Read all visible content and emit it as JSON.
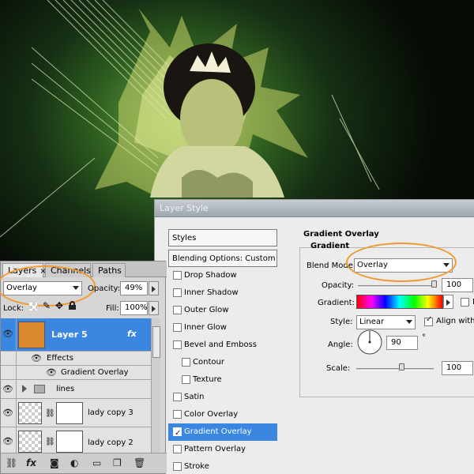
{
  "layer_style": {
    "title": "Layer Style",
    "styles_header": "Styles",
    "blending_options": "Blending Options: Custom",
    "items": [
      {
        "label": "Drop Shadow",
        "checked": false,
        "sub": false
      },
      {
        "label": "Inner Shadow",
        "checked": false,
        "sub": false
      },
      {
        "label": "Outer Glow",
        "checked": false,
        "sub": false
      },
      {
        "label": "Inner Glow",
        "checked": false,
        "sub": false
      },
      {
        "label": "Bevel and Emboss",
        "checked": false,
        "sub": false
      },
      {
        "label": "Contour",
        "checked": false,
        "sub": true
      },
      {
        "label": "Texture",
        "checked": false,
        "sub": true
      },
      {
        "label": "Satin",
        "checked": false,
        "sub": false
      },
      {
        "label": "Color Overlay",
        "checked": false,
        "sub": false
      },
      {
        "label": "Gradient Overlay",
        "checked": true,
        "sub": false,
        "selected": true
      },
      {
        "label": "Pattern Overlay",
        "checked": false,
        "sub": false
      },
      {
        "label": "Stroke",
        "checked": false,
        "sub": false
      }
    ],
    "gradient_overlay": {
      "group_title": "Gradient Overlay",
      "sub_title": "Gradient",
      "blend_mode_label": "Blend Mode:",
      "blend_mode_value": "Overlay",
      "opacity_label": "Opacity:",
      "opacity_value": "100",
      "opacity_fraction": 1.0,
      "gradient_label": "Gradient:",
      "reverse_label": "R",
      "style_label": "Style:",
      "style_value": "Linear",
      "align_label": "Align with l",
      "align_checked": true,
      "angle_label": "Angle:",
      "angle_value": "90",
      "angle_unit": "°",
      "scale_label": "Scale:",
      "scale_value": "100"
    }
  },
  "layers_panel": {
    "tabs": [
      "Layers",
      "Channels",
      "Paths"
    ],
    "tab_close": "×",
    "blend_mode": "Overlay",
    "opacity_label": "Opacity:",
    "opacity_value": "49%",
    "lock_label": "Lock:",
    "fill_label": "Fill:",
    "fill_value": "100%",
    "layers": [
      {
        "name": "Layer 5",
        "fx": "fx"
      },
      {
        "name": "Effects"
      },
      {
        "name": "Gradient Overlay"
      },
      {
        "name": "lines"
      },
      {
        "name": "lady copy 3"
      },
      {
        "name": "lady copy 2"
      }
    ],
    "bottom_icons": [
      "link-icon",
      "fx-icon",
      "mask-icon",
      "adjustment-icon",
      "folder-icon",
      "new-layer-icon",
      "trash-icon"
    ]
  },
  "colors": {
    "selection": "#3a86e0",
    "annotation": "#f09a30",
    "layer5_swatch": "#d8892c"
  }
}
